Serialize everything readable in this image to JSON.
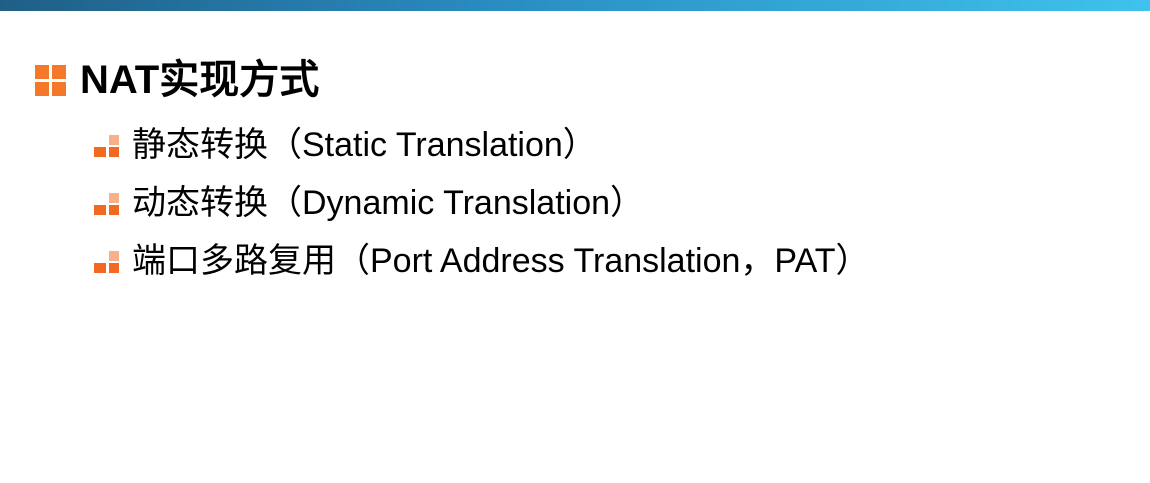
{
  "slide": {
    "heading": "NAT实现方式",
    "items": [
      {
        "label": "静态转换（Static Translation）"
      },
      {
        "label": "动态转换（Dynamic Translation）"
      },
      {
        "label": "端口多路复用（Port Address Translation，PAT）"
      }
    ]
  },
  "colors": {
    "top_bar_start": "#1f5f86",
    "top_bar_end": "#3fc2ee",
    "bullet_orange": "#f26a21",
    "bullet_light_orange": "#f8b08a"
  },
  "icons": {
    "heading_bullet": "orange-square-grid-icon",
    "item_bullet": "orange-steps-icon"
  }
}
